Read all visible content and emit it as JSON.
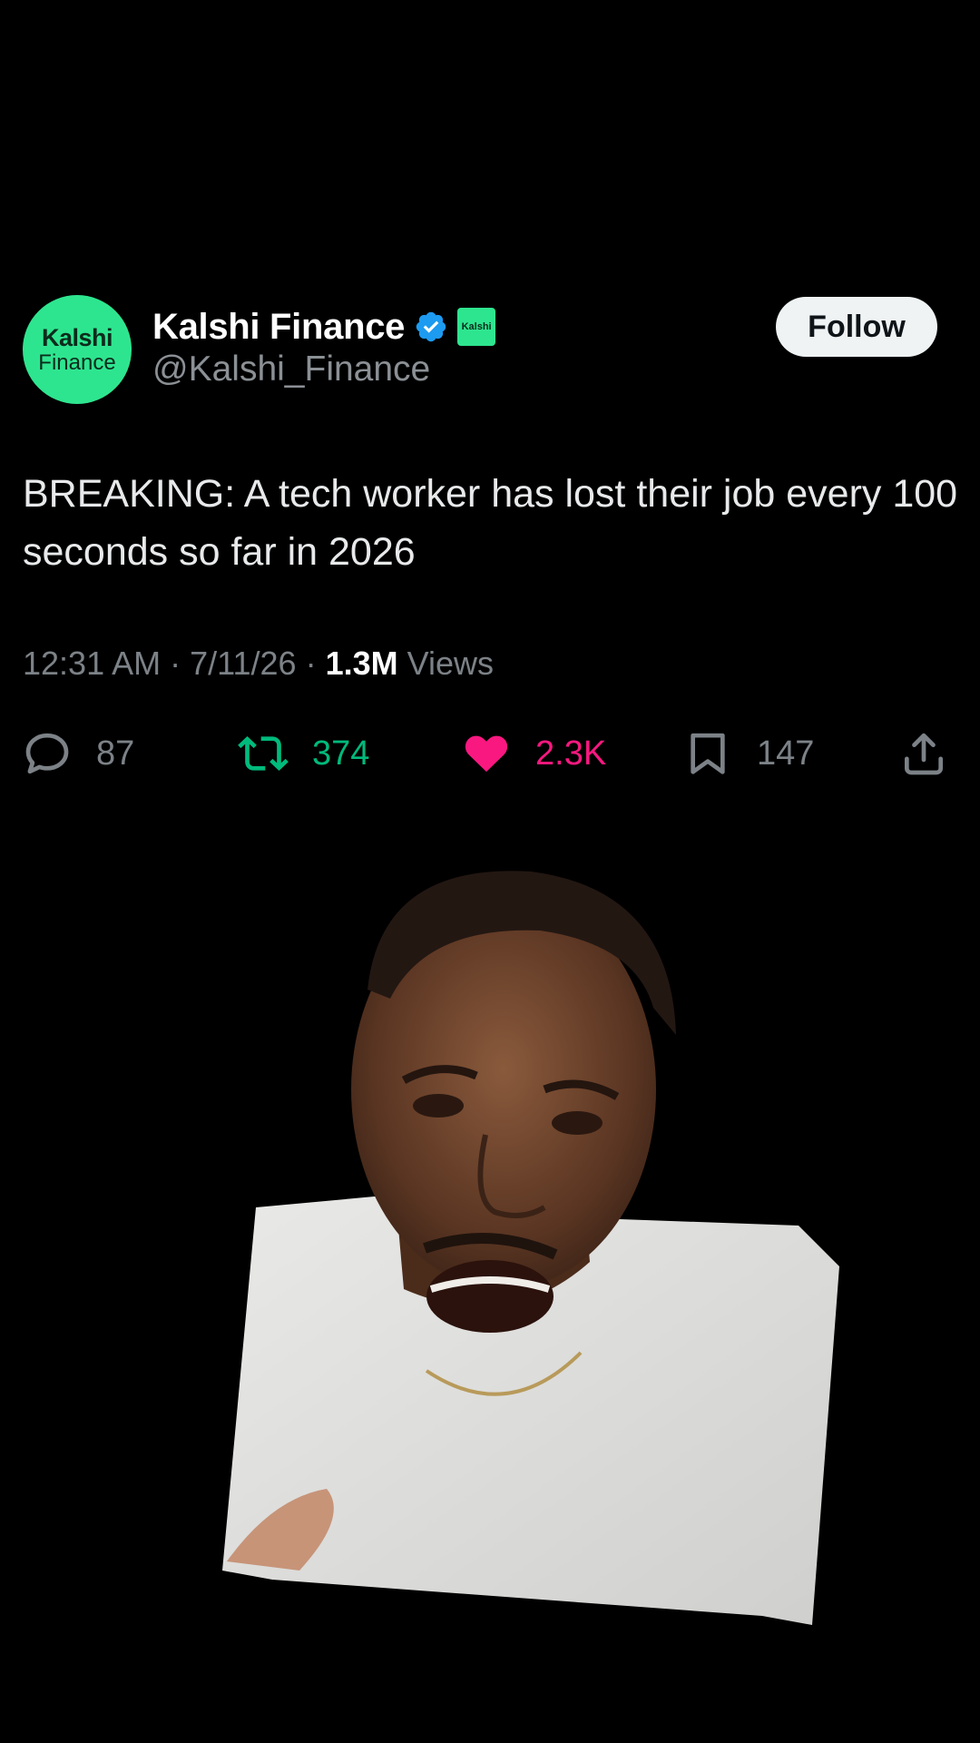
{
  "account": {
    "avatar_line1": "Kalshi",
    "avatar_line2": "Finance",
    "display_name": "Kalshi Finance",
    "handle": "@Kalshi_Finance",
    "affiliate_badge": "Kalshi",
    "verified_icon": "verified-checkmark-icon",
    "brand_color": "#2ee58f"
  },
  "follow_label": "Follow",
  "tweet": {
    "text": "BREAKING: A tech worker has lost their job every 100 seconds so far in 2026",
    "time": "12:31 AM",
    "date": "7/11/26",
    "views_count": "1.3M",
    "views_label": "Views"
  },
  "actions": {
    "replies": "87",
    "retweets": "374",
    "likes": "2.3K",
    "bookmarks": "147"
  },
  "colors": {
    "retweet": "#00ba7c",
    "like": "#f91880",
    "muted": "#7c8287",
    "verified": "#1d9bf0"
  }
}
